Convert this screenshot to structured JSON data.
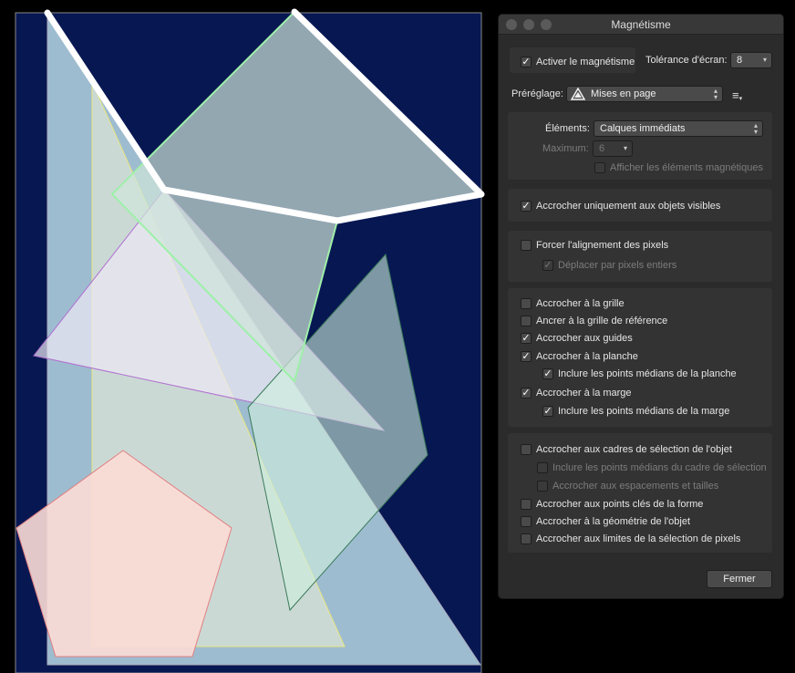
{
  "dialog": {
    "title": "Magnétisme",
    "enable_label": "Activer le magnétisme",
    "enable_checked": true,
    "tolerance_label": "Tolérance d'écran:",
    "tolerance_value": "8",
    "preset_label": "Préréglage:",
    "preset_value": "Mises en page",
    "preset_icon": "snapping-preset-icon",
    "menu_icon": "list-menu-icon",
    "elements_label": "Éléments:",
    "elements_value": "Calques immédiats",
    "maximum_label": "Maximum:",
    "maximum_value": "6",
    "show_elements_label": "Afficher les éléments magnétiques",
    "visible_only_label": "Accrocher uniquement aux objets visibles",
    "force_pixel_label": "Forcer l'alignement des pixels",
    "move_pixel_label": "Déplacer par pixels entiers",
    "grid_options": [
      {
        "label": "Accrocher à la grille",
        "checked": false,
        "indent": false
      },
      {
        "label": "Ancrer à la grille de référence",
        "checked": false,
        "indent": false
      },
      {
        "label": "Accrocher aux guides",
        "checked": true,
        "indent": false
      },
      {
        "label": "Accrocher à la planche",
        "checked": true,
        "indent": false
      },
      {
        "label": "Inclure les points médians de la planche",
        "checked": true,
        "indent": true
      },
      {
        "label": "Accrocher à la marge",
        "checked": true,
        "indent": false
      },
      {
        "label": "Inclure les points médians de la marge",
        "checked": true,
        "indent": true
      }
    ],
    "object_options": [
      {
        "label": "Accrocher aux cadres de sélection de l'objet",
        "checked": false,
        "disabled": false,
        "indent": false
      },
      {
        "label": "Inclure les points médians du cadre de sélection",
        "checked": false,
        "disabled": true,
        "indent": true
      },
      {
        "label": "Accrocher aux espacements et tailles",
        "checked": false,
        "disabled": true,
        "indent": true
      },
      {
        "label": "Accrocher aux points clés de la forme",
        "checked": false,
        "disabled": false,
        "indent": false
      },
      {
        "label": "Accrocher à la géométrie de l'objet",
        "checked": false,
        "disabled": false,
        "indent": false
      },
      {
        "label": "Accrocher aux limites de la sélection de pixels",
        "checked": false,
        "disabled": false,
        "indent": false
      }
    ],
    "close_label": "Fermer"
  },
  "colors": {
    "artboard": "#071752",
    "dialog_bg": "#2b2b2b",
    "panel_bg": "#333333"
  }
}
